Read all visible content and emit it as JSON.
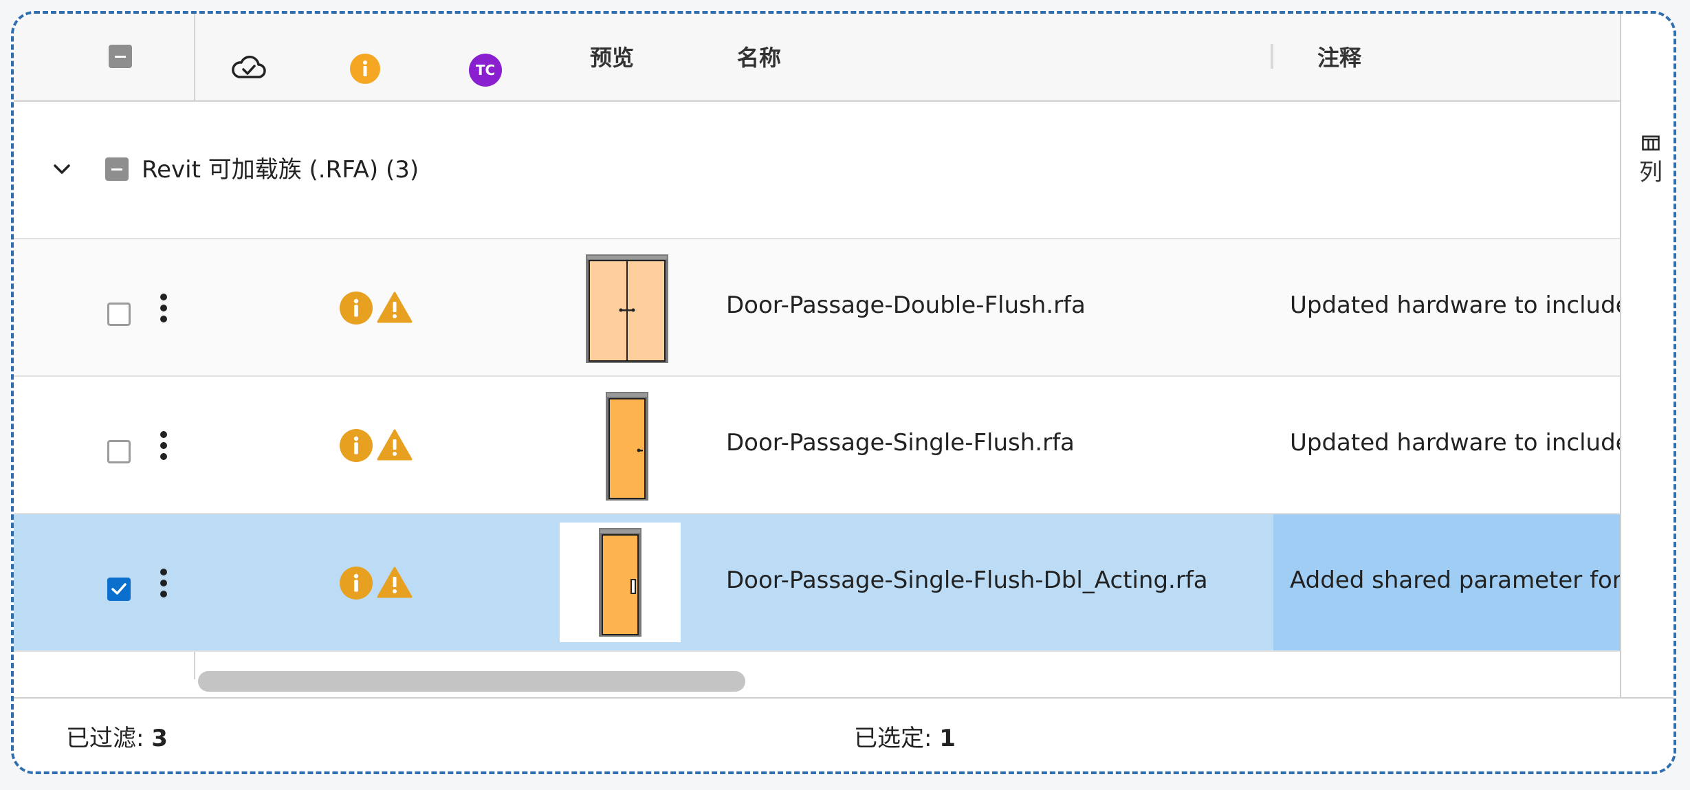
{
  "header": {
    "preview_label": "预览",
    "name_label": "名称",
    "notes_label": "注释",
    "tc_badge": "TC",
    "select_all_state": "indeterminate",
    "icons": [
      "cloud-check-icon",
      "info-icon",
      "tc-badge-icon"
    ]
  },
  "group": {
    "label": "Revit 可加载族 (.RFA) (3)",
    "expanded": true,
    "checkbox_state": "indeterminate"
  },
  "rows": [
    {
      "name": "Door-Passage-Double-Flush.rfa",
      "note": "Updated hardware to include",
      "checked": false,
      "preview": "double-door-thumbnail",
      "status_icons": [
        "info-icon",
        "warning-icon"
      ]
    },
    {
      "name": "Door-Passage-Single-Flush.rfa",
      "note": "Updated hardware to include",
      "checked": false,
      "preview": "single-door-thumbnail",
      "status_icons": [
        "info-icon",
        "warning-icon"
      ]
    },
    {
      "name": "Door-Passage-Single-Flush-Dbl_Acting.rfa",
      "note": "Added shared parameter for d",
      "checked": true,
      "preview": "single-door-double-acting-thumbnail",
      "status_icons": [
        "info-icon",
        "warning-icon"
      ]
    }
  ],
  "side_panel": {
    "columns_label": "列"
  },
  "footer": {
    "filtered_label": "已过滤: ",
    "filtered_count": "3",
    "selected_label": "已选定: ",
    "selected_count": "1"
  },
  "colors": {
    "frame_border": "#2f6fb0",
    "selected_row": "#bcdcf5",
    "selected_note_cell": "#9fcdf3",
    "checkbox_checked": "#0b6fce",
    "checkbox_indeterminate": "#8e8e8e",
    "info_warning": "#e8a021",
    "tc_badge": "#8a1fd0",
    "door_double": "#fdcf9d",
    "door_single": "#fdb44f"
  }
}
